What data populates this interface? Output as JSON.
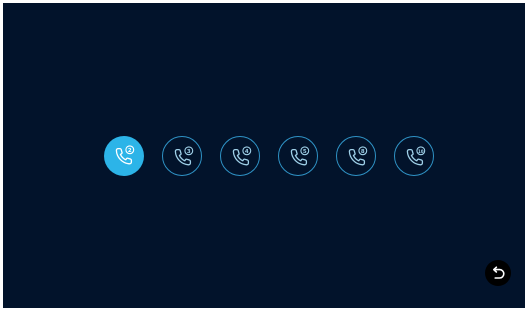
{
  "ring_options": [
    {
      "count": "2",
      "selected": true
    },
    {
      "count": "3",
      "selected": false
    },
    {
      "count": "4",
      "selected": false
    },
    {
      "count": "5",
      "selected": false
    },
    {
      "count": "8",
      "selected": false
    },
    {
      "count": "10",
      "selected": false
    }
  ],
  "icons": {
    "ring_option": "phone-ring-icon",
    "back": "back-arrow-icon"
  },
  "colors": {
    "background": "#02132b",
    "selected_fill": "#2cb4e8",
    "outline": "#2f93c6",
    "icon_selected": "#ffffff",
    "icon_normal": "#9fd0e8"
  }
}
